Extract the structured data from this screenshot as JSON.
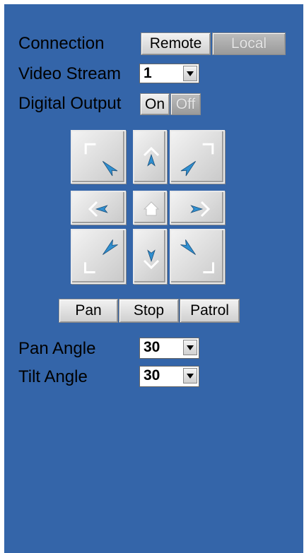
{
  "connection": {
    "label": "Connection",
    "remote": "Remote",
    "local": "Local"
  },
  "video_stream": {
    "label": "Video Stream",
    "value": "1"
  },
  "digital_output": {
    "label": "Digital Output",
    "on": "On",
    "off": "Off"
  },
  "ptz": {
    "icons": [
      "up-left-arrow-icon",
      "up-arrow-icon",
      "up-right-arrow-icon",
      "left-arrow-icon",
      "home-icon",
      "right-arrow-icon",
      "down-left-arrow-icon",
      "down-arrow-icon",
      "down-right-arrow-icon"
    ]
  },
  "actions": {
    "pan": "Pan",
    "stop": "Stop",
    "patrol": "Patrol"
  },
  "pan_angle": {
    "label": "Pan Angle",
    "value": "30"
  },
  "tilt_angle": {
    "label": "Tilt Angle",
    "value": "30"
  },
  "colors": {
    "panel": "#3465a9",
    "accent_arrow": "#2f8fd0"
  }
}
